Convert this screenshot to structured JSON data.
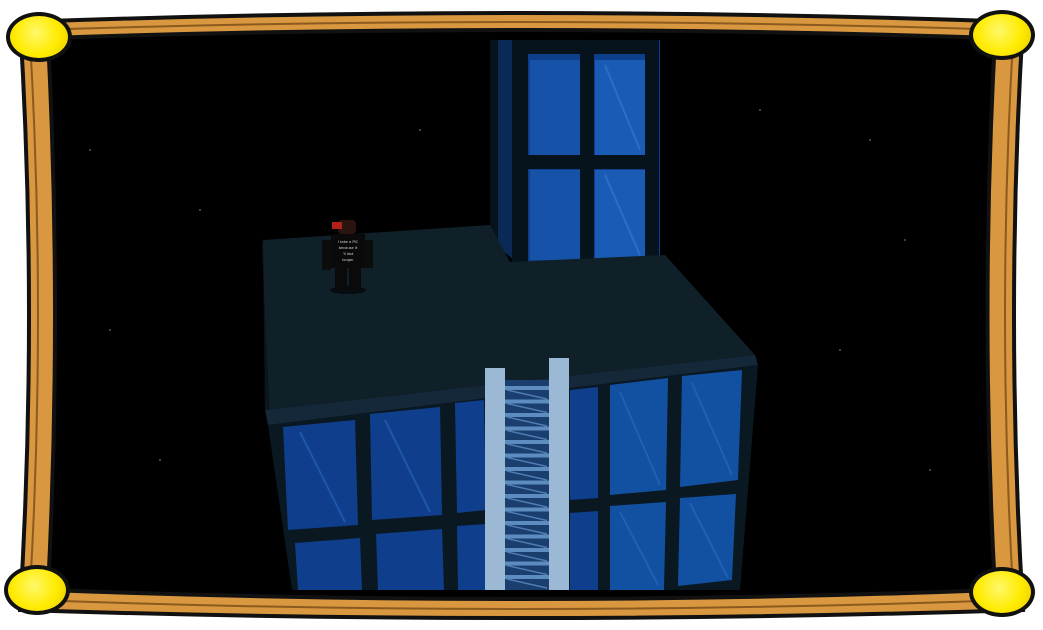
{
  "window": {
    "frame_color": "#d9973f",
    "frame_outline": "#111111",
    "corner_color": "#ffeb00"
  },
  "scene": {
    "sky_color": "#000000",
    "floor_color": "#101c24",
    "glass_color": "#0d3d87",
    "mullion_color": "#09141c",
    "ladder_rail_color": "#9bb8d4",
    "ladder_rung_color": "#5d8cc0",
    "rung_count": 15
  },
  "player": {
    "shirt_text": [
      "I take a PIC",
      "because it",
      "'ll last",
      "longer"
    ]
  }
}
